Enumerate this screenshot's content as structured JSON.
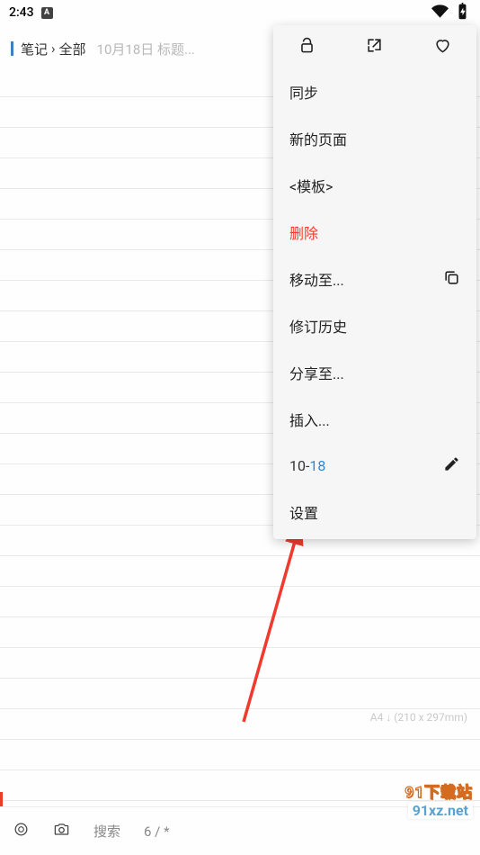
{
  "status": {
    "time": "2:43",
    "badge": "A"
  },
  "breadcrumb": {
    "root": "笔记",
    "sep": "›",
    "folder": "全部",
    "note": "10月18日 标题..."
  },
  "page_info": "A4  ↓ (210 x 297mm)",
  "bottom": {
    "search": "搜索",
    "counter": "6 / *"
  },
  "menu": {
    "sync": "同步",
    "new_page": "新的页面",
    "template": "<模板>",
    "delete": "删除",
    "move_to": "移动至...",
    "history": "修订历史",
    "share_to": "分享至...",
    "insert": "插入...",
    "date_prefix": "10-",
    "date_suffix": "18",
    "settings": "设置"
  },
  "watermark": {
    "line1": "91下载站",
    "line2": "91xz.net"
  }
}
